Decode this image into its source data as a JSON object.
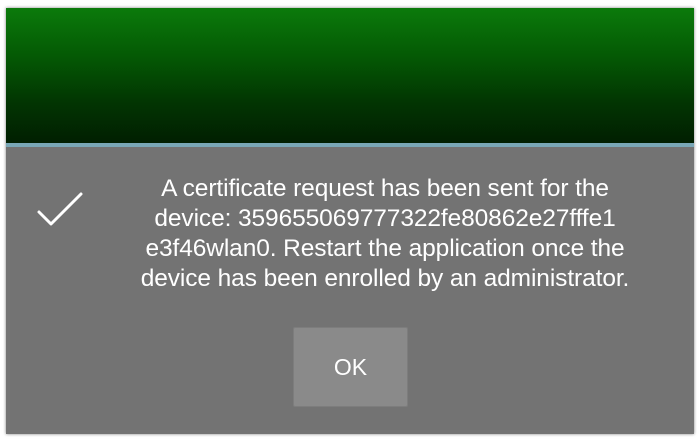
{
  "dialog": {
    "icon": "checkmark-icon",
    "message_lines": [
      "A certificate request has been sent for the",
      "device: 359655069777322fe80862e27fffe1",
      "e3f46wlan0. Restart the application once the",
      "device has been enrolled by an administrator."
    ],
    "ok_label": "OK"
  },
  "colors": {
    "header_gradient_top": "#0b7a0b",
    "header_gradient_bottom": "#011f01",
    "divider": "#79a7b6",
    "dialog_background": "#737373",
    "button_background": "#8a8a8a",
    "text": "#ffffff"
  }
}
